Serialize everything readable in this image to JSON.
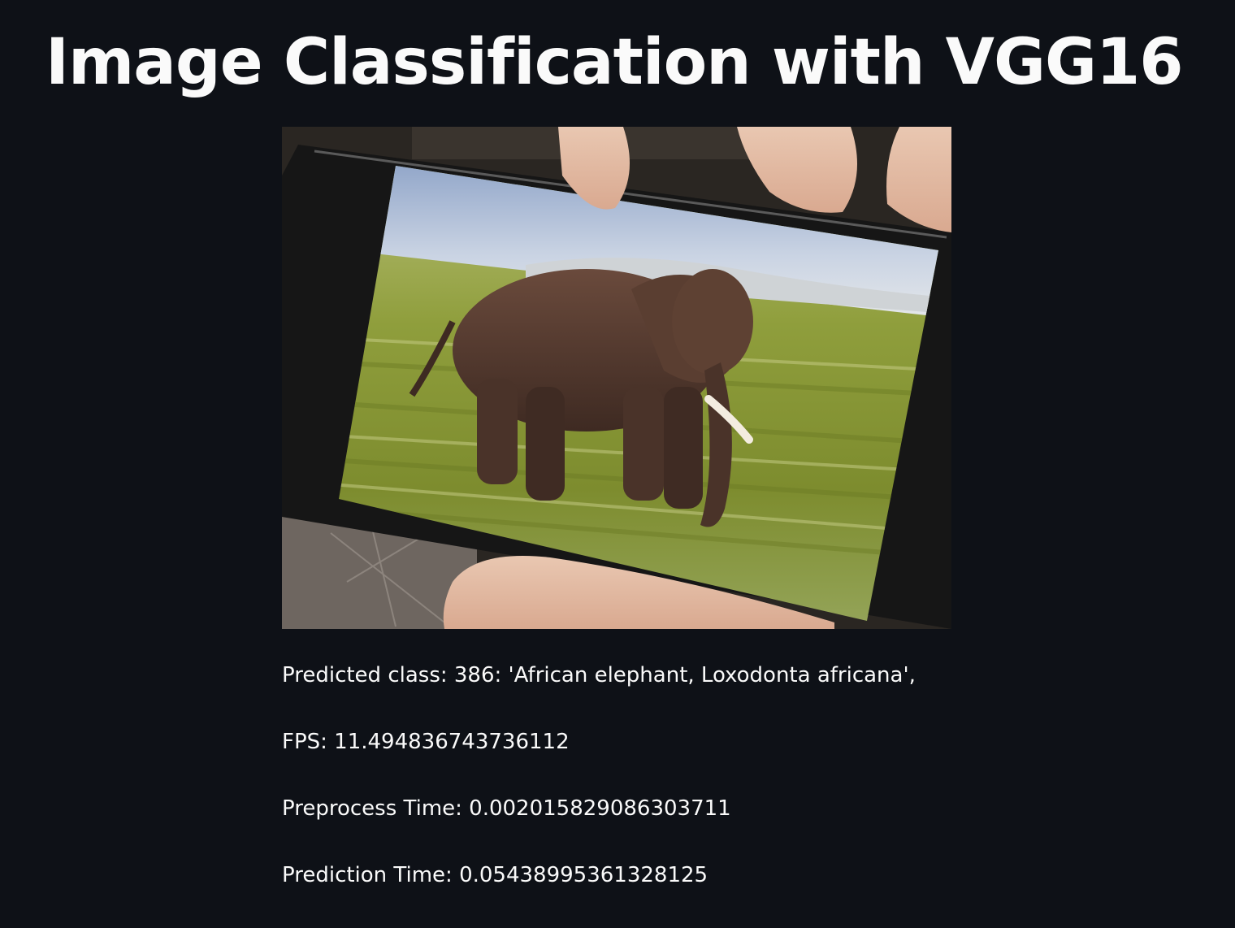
{
  "app": {
    "title": "Image Classification with VGG16"
  },
  "image": {
    "subject": "photo of a phone screen showing an African elephant in a grassy plain, held in a hand"
  },
  "results": {
    "predicted_class": "Predicted class: 386: 'African elephant, Loxodonta africana',",
    "fps": "FPS: 11.494836743736112",
    "preprocess_time": "Preprocess Time: 0.002015829086303711",
    "prediction_time": "Prediction Time: 0.05438995361328125"
  },
  "colors": {
    "background": "#0e1117",
    "text": "#fafafa"
  }
}
